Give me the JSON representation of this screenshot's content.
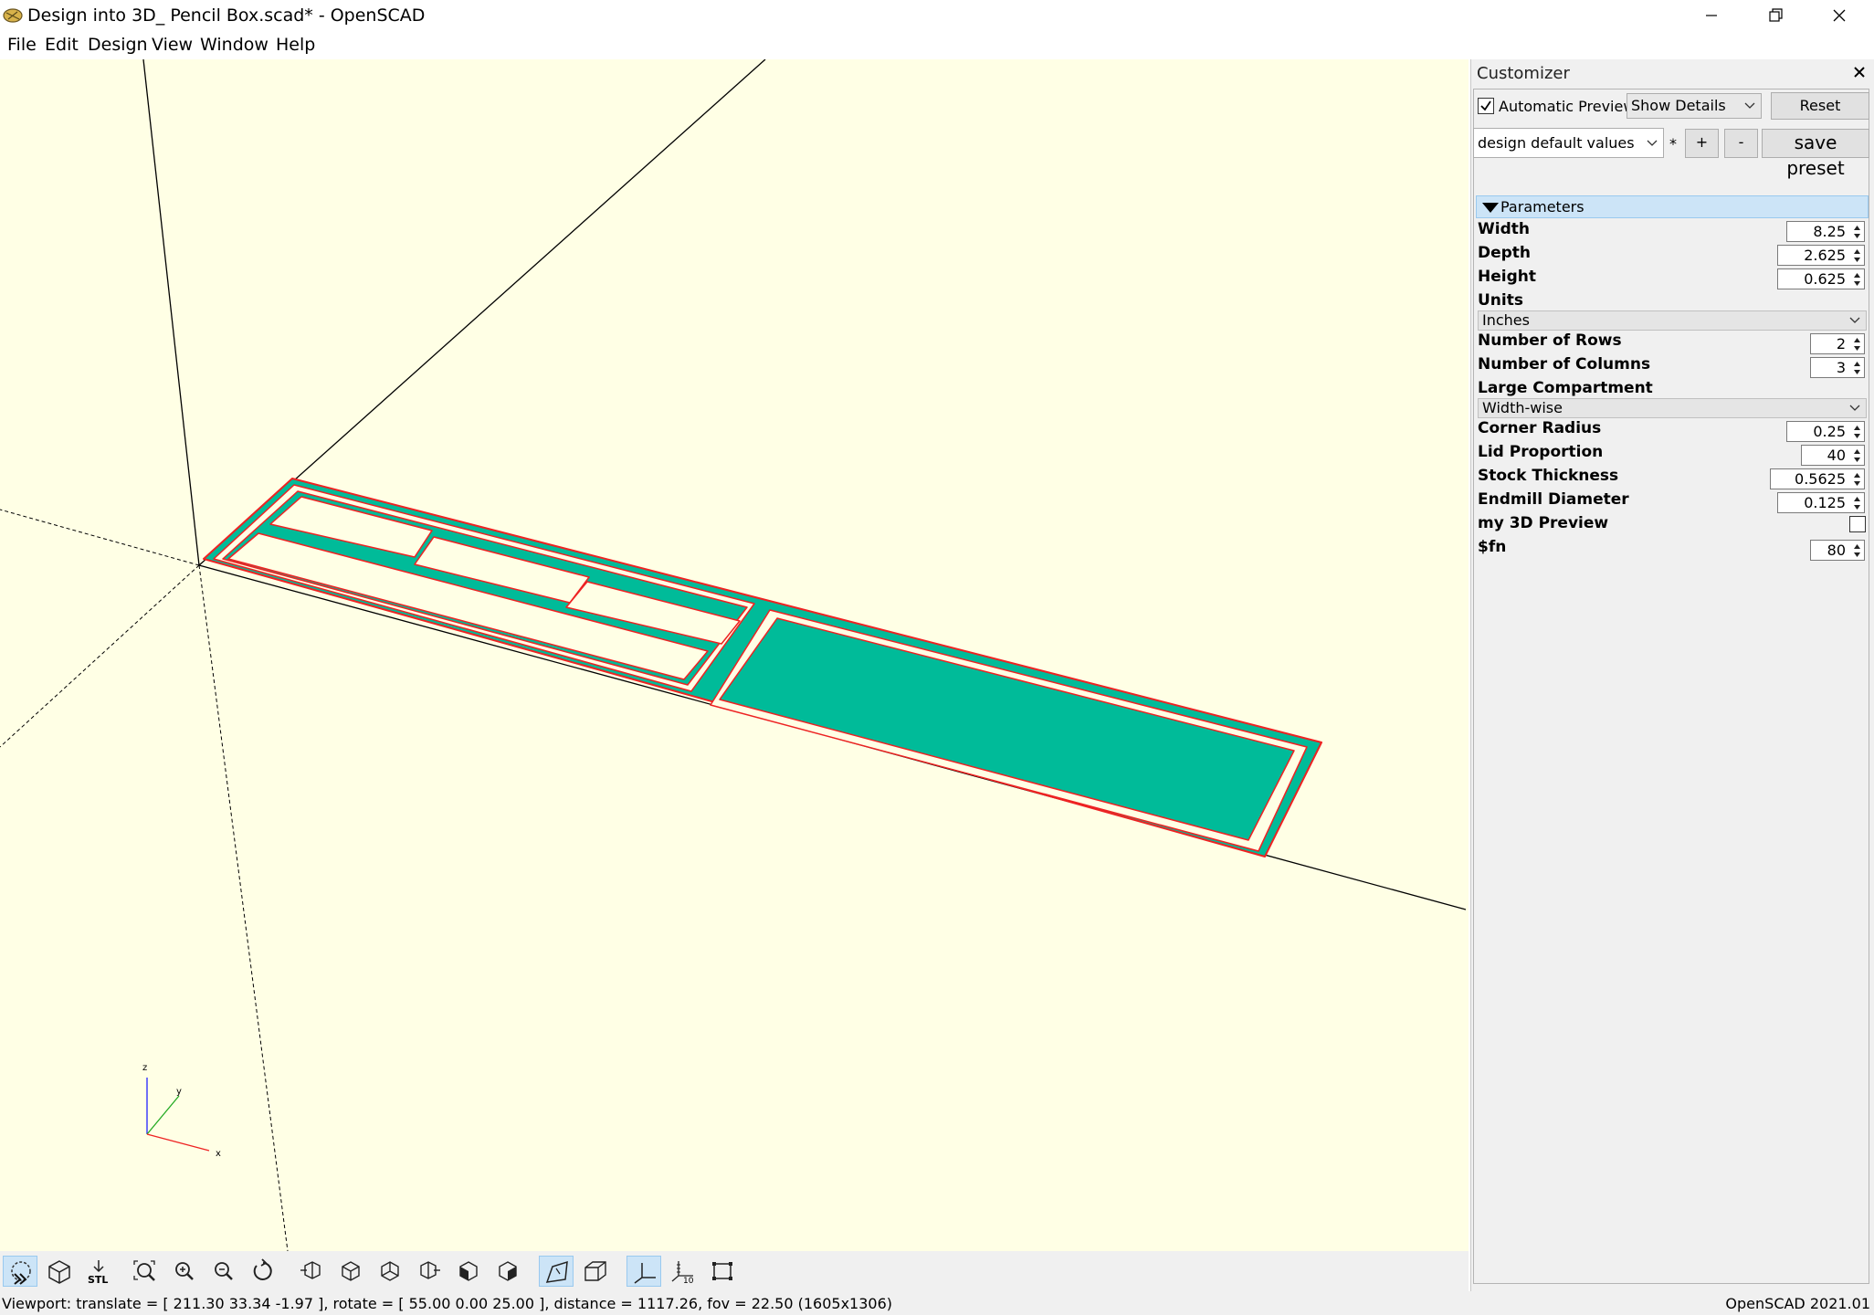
{
  "window": {
    "title": "Design into 3D_ Pencil Box.scad* - OpenSCAD"
  },
  "menu": [
    "File",
    "Edit",
    "Design",
    "View",
    "Window",
    "Help"
  ],
  "axes_widget": {
    "z": "z",
    "y": "y",
    "x": "x"
  },
  "customizer": {
    "title": "Customizer",
    "automatic_preview_label": "Automatic Preview",
    "automatic_preview_checked": true,
    "details_select": "Show Details",
    "reset_label": "Reset",
    "preset_select": "design default values",
    "preset_modified": "*",
    "add_preset_label": "+",
    "remove_preset_label": "-",
    "save_preset_label": "save preset",
    "section_label": "Parameters",
    "params": {
      "width": {
        "label": "Width",
        "value": "8.25"
      },
      "depth": {
        "label": "Depth",
        "value": "2.625"
      },
      "height": {
        "label": "Height",
        "value": "0.625"
      },
      "units": {
        "label": "Units",
        "value": "Inches"
      },
      "rows": {
        "label": "Number of Rows",
        "value": "2"
      },
      "columns": {
        "label": "Number of Columns",
        "value": "3"
      },
      "large": {
        "label": "Large Compartment",
        "value": "Width-wise"
      },
      "corner": {
        "label": "Corner Radius",
        "value": "0.25"
      },
      "lid": {
        "label": "Lid Proportion",
        "value": "40"
      },
      "stock": {
        "label": "Stock Thickness",
        "value": "0.5625"
      },
      "endmill": {
        "label": "Endmill Diameter",
        "value": "0.125"
      },
      "preview3d": {
        "label": "my 3D Preview",
        "checked": false
      },
      "fn": {
        "label": "$fn",
        "value": "80"
      }
    }
  },
  "toolbar": [
    "preview",
    "render",
    "export-stl",
    "view-all",
    "zoom-in",
    "zoom-out",
    "reset-view",
    "view-right",
    "view-top",
    "view-bottom",
    "view-left",
    "view-front",
    "view-back",
    "perspective",
    "orthogonal",
    "show-axes",
    "show-scale-markers",
    "show-edges"
  ],
  "status": {
    "viewport_text": "Viewport: translate = [ 211.30 33.34 -1.97 ], rotate = [ 55.00 0.00 25.00 ], distance = 1117.26, fov = 22.50 (1605x1306)",
    "version_text": "OpenSCAD 2021.01"
  },
  "colors": {
    "viewport_bg": "#ffffe5",
    "model_fill": "#00bb99",
    "model_edge": "#ee2222",
    "selection": "#cce4f7"
  }
}
